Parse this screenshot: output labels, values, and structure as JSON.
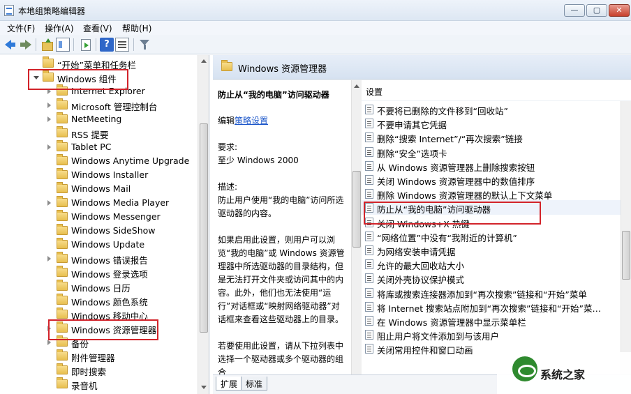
{
  "window": {
    "title": "本地组策略编辑器"
  },
  "menu": [
    "文件(F)",
    "操作(A)",
    "查看(V)",
    "帮助(H)"
  ],
  "tree": {
    "items": [
      {
        "label": "“开始”菜单和任务栏",
        "level": 1,
        "expander": "none"
      },
      {
        "label": "Windows 组件",
        "level": 1,
        "expander": "open"
      },
      {
        "label": "Internet Explorer",
        "level": 2,
        "expander": "closed"
      },
      {
        "label": "Microsoft 管理控制台",
        "level": 2,
        "expander": "closed"
      },
      {
        "label": "NetMeeting",
        "level": 2,
        "expander": "closed"
      },
      {
        "label": "RSS 提要",
        "level": 2,
        "expander": "none"
      },
      {
        "label": "Tablet PC",
        "level": 2,
        "expander": "closed"
      },
      {
        "label": "Windows Anytime Upgrade",
        "level": 2,
        "expander": "none"
      },
      {
        "label": "Windows Installer",
        "level": 2,
        "expander": "none"
      },
      {
        "label": "Windows Mail",
        "level": 2,
        "expander": "none"
      },
      {
        "label": "Windows Media Player",
        "level": 2,
        "expander": "closed"
      },
      {
        "label": "Windows Messenger",
        "level": 2,
        "expander": "none"
      },
      {
        "label": "Windows SideShow",
        "level": 2,
        "expander": "none"
      },
      {
        "label": "Windows Update",
        "level": 2,
        "expander": "none"
      },
      {
        "label": "Windows 错误报告",
        "level": 2,
        "expander": "closed"
      },
      {
        "label": "Windows 登录选项",
        "level": 2,
        "expander": "none"
      },
      {
        "label": "Windows 日历",
        "level": 2,
        "expander": "none"
      },
      {
        "label": "Windows 颜色系统",
        "level": 2,
        "expander": "none"
      },
      {
        "label": "Windows 移动中心",
        "level": 2,
        "expander": "none"
      },
      {
        "label": "Windows 资源管理器",
        "level": 2,
        "expander": "closed"
      },
      {
        "label": "备份",
        "level": 2,
        "expander": "closed"
      },
      {
        "label": "附件管理器",
        "level": 2,
        "expander": "none"
      },
      {
        "label": "即时搜索",
        "level": 2,
        "expander": "none"
      },
      {
        "label": "录音机",
        "level": 2,
        "expander": "none"
      }
    ]
  },
  "right_header": {
    "title": "Windows 资源管理器"
  },
  "description": {
    "title": "防止从“我的电脑”访问驱动器",
    "edit_prefix": "编辑",
    "edit_link": "策略设置",
    "req_label": "要求:",
    "req_value": "至少 Windows 2000",
    "desc_label": "描述:",
    "desc_text": "防止用户使用“我的电脑”访问所选驱动器的内容。",
    "enabled_text": "如果启用此设置，则用户可以浏览“我的电脑”或 Windows 资源管理器中所选驱动器的目录结构，但是无法打开文件夹或访问其中的内容。此外，他们也无法使用“运行”对话框或“映射网络驱动器”对话框来查看这些驱动器上的目录。",
    "usage_text": "若要使用此设置，请从下拉列表中选择一个驱动器或多个驱动器的组合"
  },
  "settings": {
    "header": "设置",
    "items": [
      "不要将已删除的文件移到“回收站”",
      "不要申请其它凭据",
      "删除“搜索 Internet”/“再次搜索”链接",
      "删除“安全”选项卡",
      "从 Windows 资源管理器上删除搜索按钮",
      "关闭 Windows 资源管理器中的数值排序",
      "删除 Windows 资源管理器的默认上下文菜单",
      "防止从“我的电脑”访问驱动器",
      "关闭 Windows+X 热键",
      "“网络位置”中没有“我附近的计算机”",
      "为网络安装申请凭据",
      "允许的最大回收站大小",
      "关闭外壳协议保护模式",
      "将库或搜索连接器添加到“再次搜索”链接和“开始”菜单",
      "将 Internet 搜索站点附加到“再次搜索”链接和“开始”菜…",
      "在 Windows 资源管理器中显示菜单栏",
      "阻止用户将文件添加到与该用户",
      "关闭常用控件和窗口动画"
    ],
    "selected_index": 7
  },
  "tabs": [
    "扩展",
    "标准"
  ],
  "watermark": {
    "text": "系统之家"
  }
}
